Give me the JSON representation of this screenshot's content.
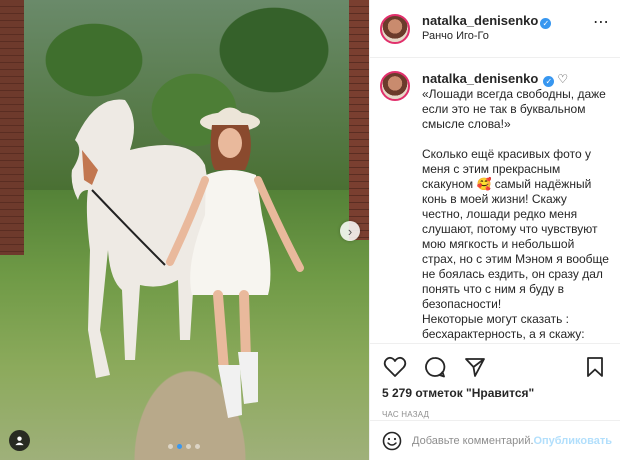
{
  "post": {
    "username": "natalka_denisenko",
    "location": "Ранчо Иго-Го",
    "caption_p1": "«Лошади всегда свободны, даже если это не так в буквальном смысле слова!»",
    "caption_p2": "Сколько ещё красивых фото у меня с этим прекрасным скакуном 🥰 самый надёжный конь в моей жизни! Скажу честно, лошади редко меня слушают, потому что чувствуют мою мягкость и небольшой страх, но с этим Мэном я вообще не боялась ездить, он сразу дал понять что с ним я буду в безопасности!\nНекоторые могут сказать : бесхарактерность, а я скажу: великая сила!\nВедь даже не каждый человек может дать это ощущение - просто",
    "likes": "5 279 отметок \"Нравится\"",
    "time": "ЧАС НАЗАД"
  },
  "comment": {
    "placeholder": "Добавьте комментарий...",
    "publish_label": "Опубликовать"
  },
  "carousel": {
    "total": 4,
    "active_index": 1
  },
  "icons": {
    "more": "more-options-icon",
    "like": "heart-icon",
    "comment": "comment-icon",
    "share": "share-icon",
    "save": "bookmark-icon",
    "emoji": "emoji-icon",
    "next": "chevron-right-icon",
    "tags": "user-tag-icon",
    "verified": "verified-badge-icon"
  },
  "colors": {
    "accent": "#3897f0",
    "publish_disabled": "#b2dffc",
    "text": "#262626",
    "muted": "#8e8e8e"
  }
}
